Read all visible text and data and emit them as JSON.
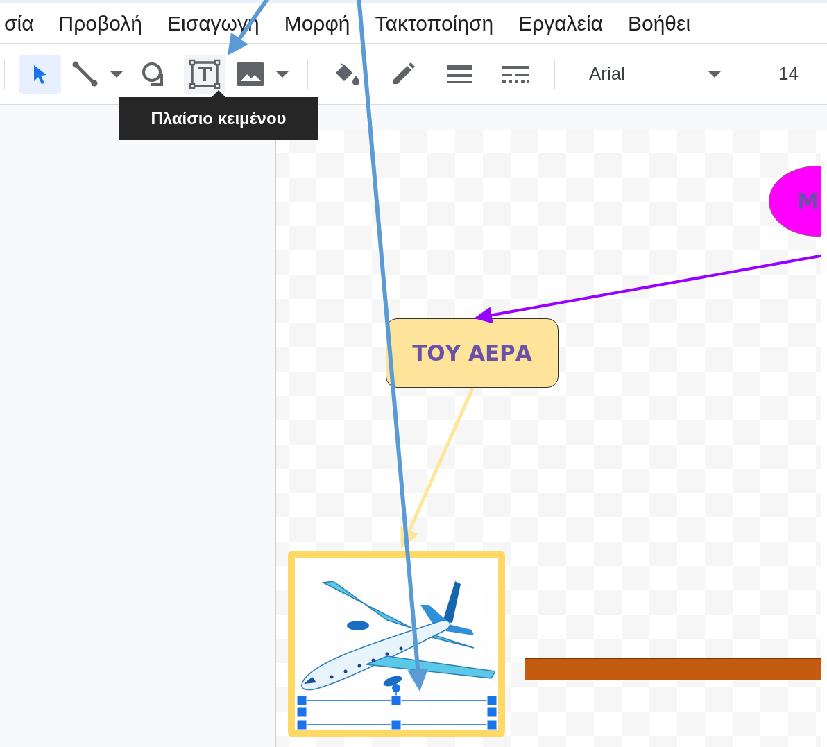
{
  "menu": [
    {
      "label": "σία"
    },
    {
      "label": "Προβολή"
    },
    {
      "label": "Εισαγωγή"
    },
    {
      "label": "Μορφή"
    },
    {
      "label": "Τακτοποίηση"
    },
    {
      "label": "Εργαλεία"
    },
    {
      "label": "Βοήθει"
    }
  ],
  "toolbar": {
    "tools": [
      {
        "kind": "select",
        "selected": true,
        "hovered": false,
        "has_menu": false
      },
      {
        "kind": "line",
        "selected": false,
        "hovered": false,
        "has_menu": true
      },
      {
        "kind": "shape",
        "selected": false,
        "hovered": false,
        "has_menu": false
      },
      {
        "kind": "textbox",
        "selected": false,
        "hovered": true,
        "has_menu": false
      },
      {
        "kind": "image",
        "selected": false,
        "hovered": false,
        "has_menu": true
      },
      {
        "kind": "fill",
        "selected": false,
        "hovered": false,
        "has_menu": false
      },
      {
        "kind": "pen",
        "selected": false,
        "hovered": false,
        "has_menu": false
      },
      {
        "kind": "weight",
        "selected": false,
        "hovered": false,
        "has_menu": false
      },
      {
        "kind": "dash",
        "selected": false,
        "hovered": false,
        "has_menu": false
      }
    ],
    "font": "Arial",
    "font_size": "14"
  },
  "tooltip": {
    "text": "Πλαίσιο κειμένου"
  },
  "canvas": {
    "shapes": [
      {
        "kind": "ellipse",
        "text": "M",
        "color": "#ff00ff"
      },
      {
        "kind": "rounded-box",
        "text": "ΤΟΥ ΑΕΡΑ",
        "color": "#fde49a"
      },
      {
        "kind": "image-frame",
        "color": "#ffd966"
      },
      {
        "kind": "bar",
        "color": "#c55a11"
      }
    ],
    "text_box": {
      "selected": true
    }
  }
}
